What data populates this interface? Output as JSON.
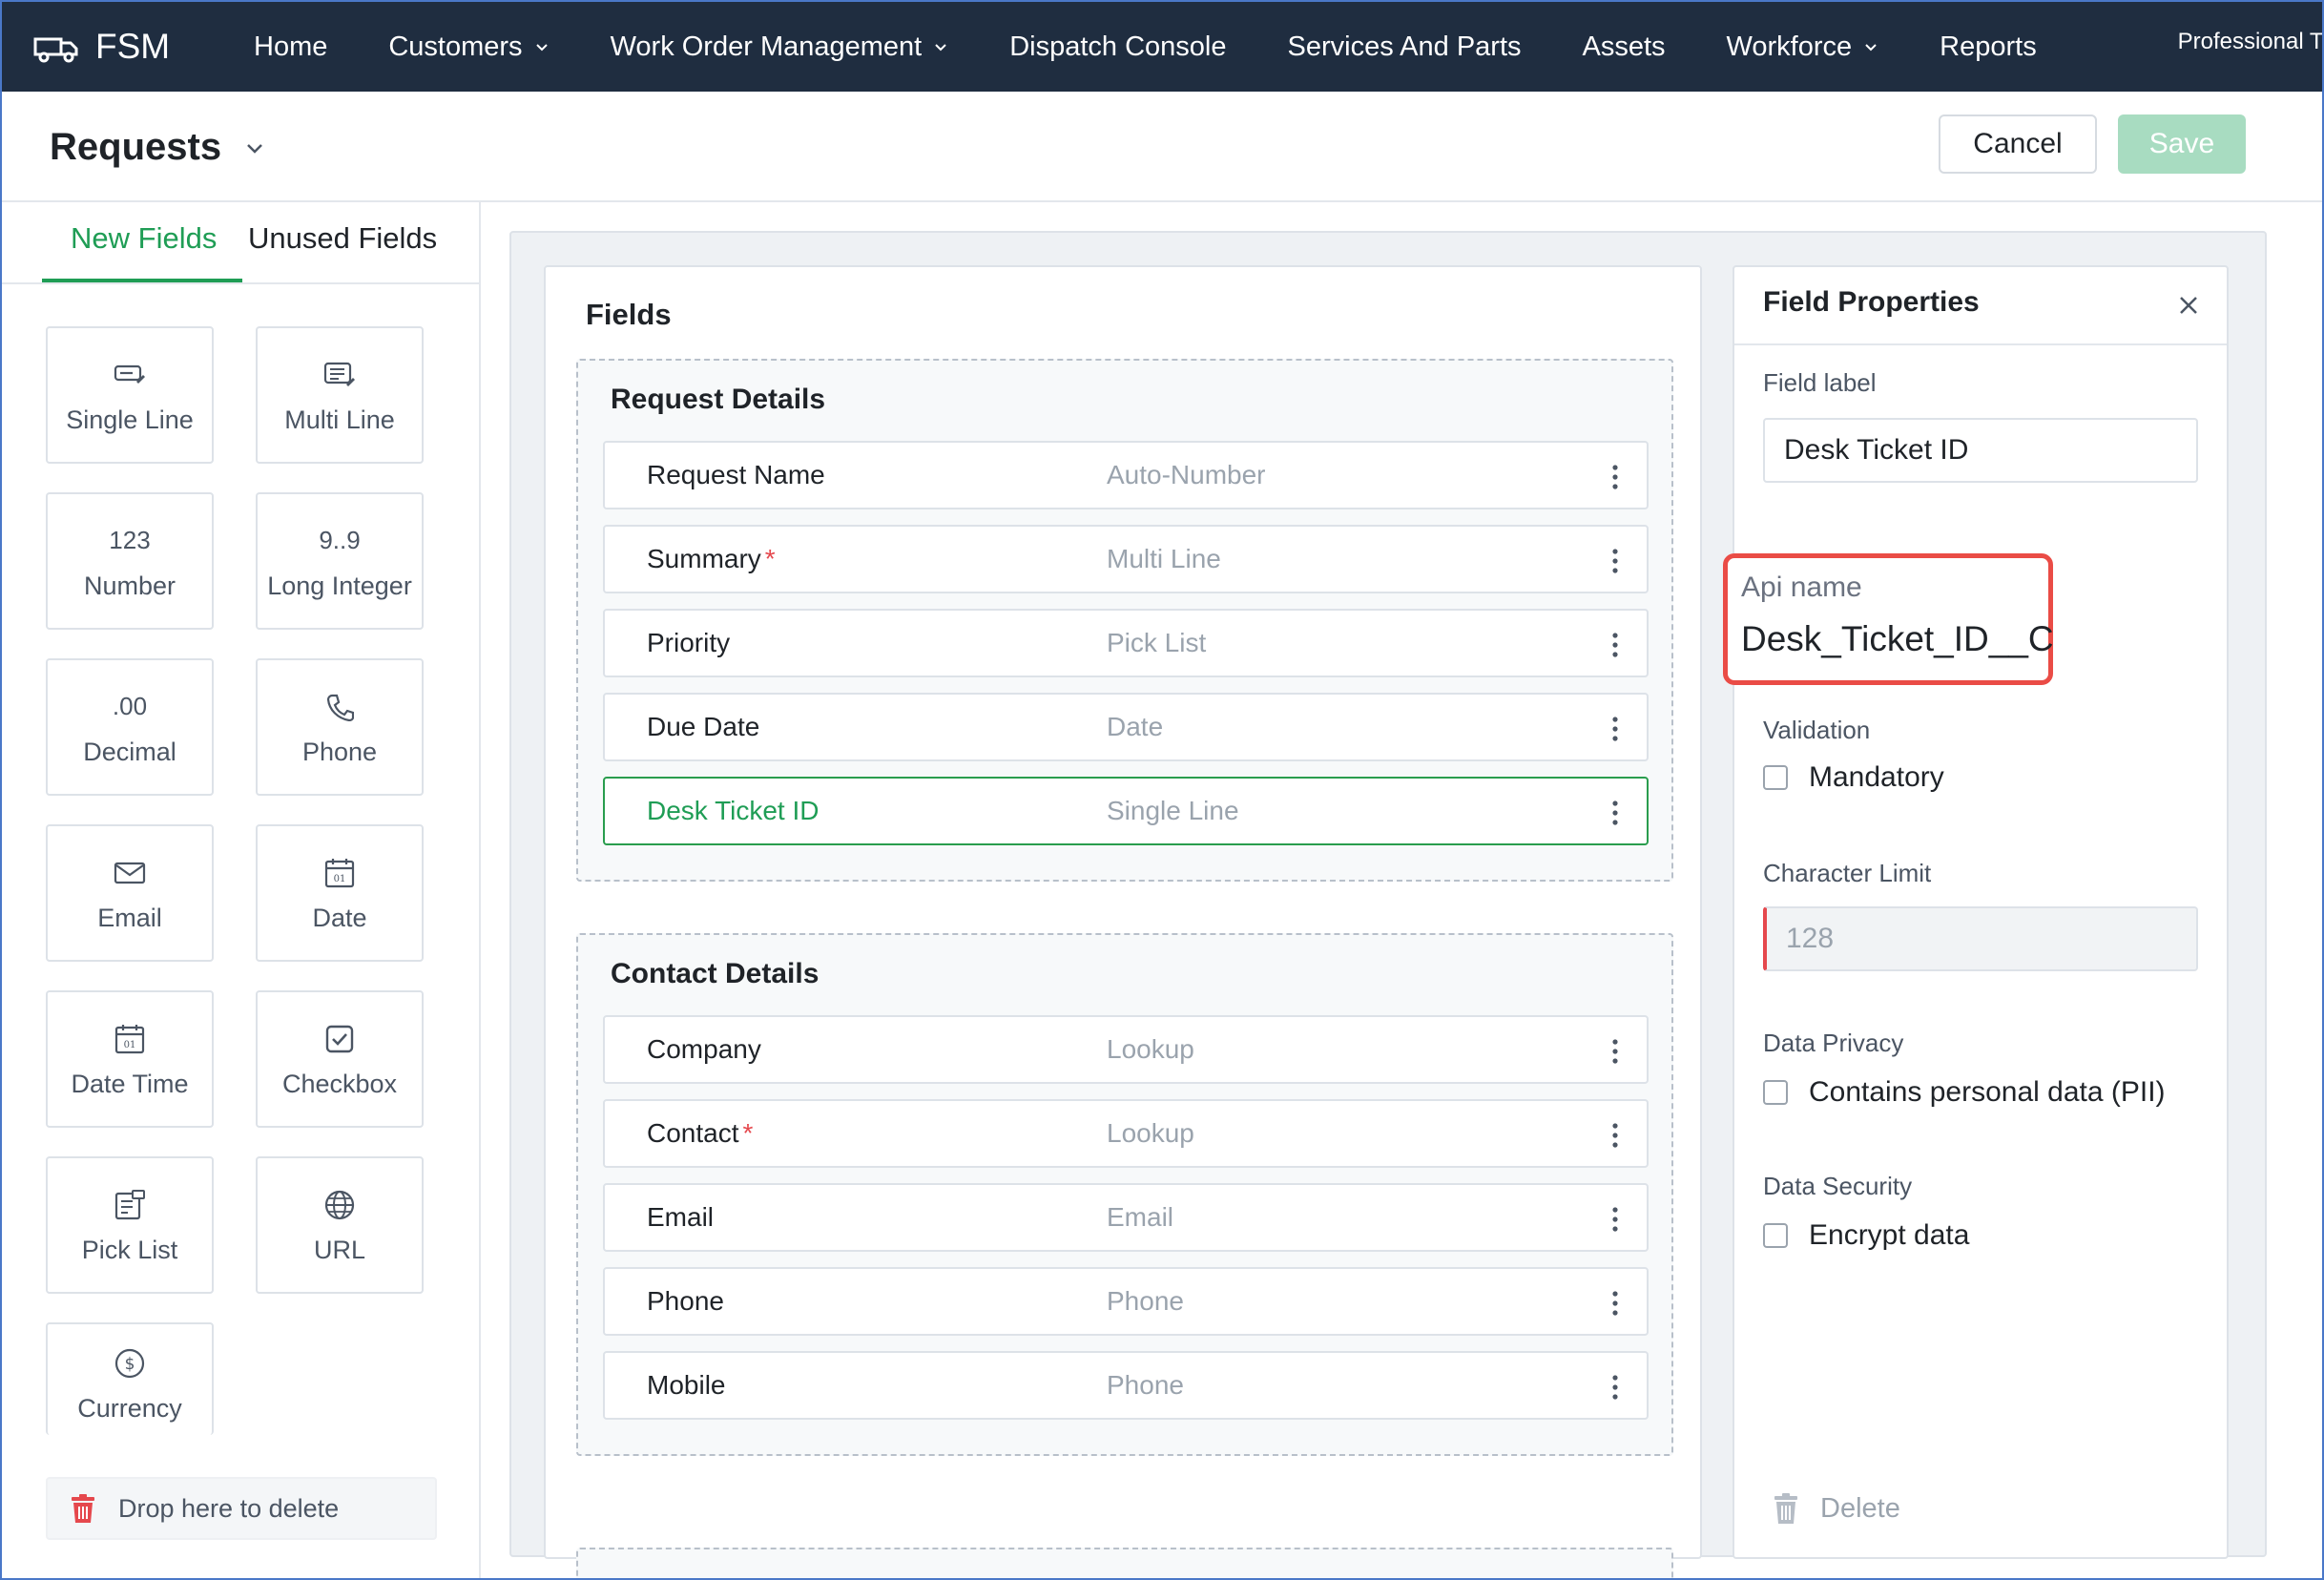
{
  "app": {
    "brand": "FSM",
    "nav": [
      {
        "label": "Home",
        "has_dropdown": false
      },
      {
        "label": "Customers",
        "has_dropdown": true
      },
      {
        "label": "Work Order Management",
        "has_dropdown": true
      },
      {
        "label": "Dispatch Console",
        "has_dropdown": false
      },
      {
        "label": "Services And Parts",
        "has_dropdown": false
      },
      {
        "label": "Assets",
        "has_dropdown": false
      },
      {
        "label": "Workforce",
        "has_dropdown": true
      },
      {
        "label": "Reports",
        "has_dropdown": false
      }
    ],
    "nav_right": "Professional Tri"
  },
  "header": {
    "title": "Requests",
    "cancel_label": "Cancel",
    "save_label": "Save"
  },
  "sidebar": {
    "tabs": [
      "New Fields",
      "Unused Fields"
    ],
    "active_tab": "New Fields",
    "tiles": [
      {
        "label": "Single Line",
        "icon": "single-line-icon",
        "glyph": ""
      },
      {
        "label": "Multi Line",
        "icon": "multi-line-icon",
        "glyph": ""
      },
      {
        "label": "Number",
        "icon": "number-icon",
        "glyph": "123"
      },
      {
        "label": "Long Integer",
        "icon": "long-integer-icon",
        "glyph": "9..9"
      },
      {
        "label": "Decimal",
        "icon": "decimal-icon",
        "glyph": ".00"
      },
      {
        "label": "Phone",
        "icon": "phone-icon",
        "glyph": ""
      },
      {
        "label": "Email",
        "icon": "email-icon",
        "glyph": ""
      },
      {
        "label": "Date",
        "icon": "date-icon",
        "glyph": ""
      },
      {
        "label": "Date Time",
        "icon": "date-time-icon",
        "glyph": ""
      },
      {
        "label": "Checkbox",
        "icon": "checkbox-icon",
        "glyph": ""
      },
      {
        "label": "Pick List",
        "icon": "pick-list-icon",
        "glyph": ""
      },
      {
        "label": "URL",
        "icon": "globe-icon",
        "glyph": ""
      },
      {
        "label": "Currency",
        "icon": "currency-icon",
        "glyph": ""
      }
    ],
    "drop_zone": "Drop here to delete"
  },
  "fields": {
    "title": "Fields",
    "sections": [
      {
        "title": "Request Details",
        "rows": [
          {
            "label": "Request Name",
            "type": "Auto-Number",
            "required": false,
            "selected": false
          },
          {
            "label": "Summary",
            "type": "Multi Line",
            "required": true,
            "selected": false
          },
          {
            "label": "Priority",
            "type": "Pick List",
            "required": false,
            "selected": false
          },
          {
            "label": "Due Date",
            "type": "Date",
            "required": false,
            "selected": false
          },
          {
            "label": "Desk Ticket ID",
            "type": "Single Line",
            "required": false,
            "selected": true
          }
        ]
      },
      {
        "title": "Contact Details",
        "rows": [
          {
            "label": "Company",
            "type": "Lookup",
            "required": false,
            "selected": false
          },
          {
            "label": "Contact",
            "type": "Lookup",
            "required": true,
            "selected": false
          },
          {
            "label": "Email",
            "type": "Email",
            "required": false,
            "selected": false
          },
          {
            "label": "Phone",
            "type": "Phone",
            "required": false,
            "selected": false
          },
          {
            "label": "Mobile",
            "type": "Phone",
            "required": false,
            "selected": false
          }
        ]
      }
    ],
    "required_marker": "*"
  },
  "properties": {
    "title": "Field Properties",
    "field_label_caption": "Field label",
    "field_label_value": "Desk Ticket ID",
    "api_name_caption": "Api name",
    "api_name_value": "Desk_Ticket_ID__C",
    "validation_caption": "Validation",
    "mandatory_label": "Mandatory",
    "mandatory_checked": false,
    "char_limit_caption": "Character Limit",
    "char_limit_value": "128",
    "privacy_caption": "Data Privacy",
    "privacy_label": "Contains personal data (PII)",
    "privacy_checked": false,
    "security_caption": "Data Security",
    "security_label": "Encrypt data",
    "security_checked": false,
    "delete_label": "Delete"
  },
  "colors": {
    "nav_bg": "#1f2d40",
    "accent_green": "#1f9d55",
    "save_disabled": "#a8dcc1",
    "highlight_red": "#ea4c46",
    "required_red": "#e5484d"
  }
}
